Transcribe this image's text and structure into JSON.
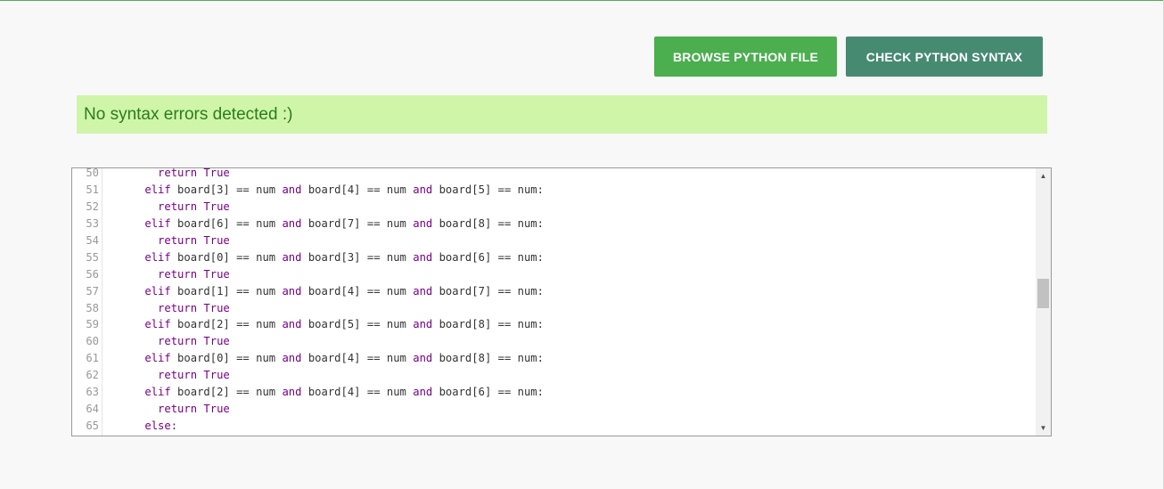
{
  "toolbar": {
    "browse_label": "BROWSE PYTHON FILE",
    "check_label": "CHECK PYTHON SYNTAX"
  },
  "status": {
    "message": "No syntax errors detected :)"
  },
  "colors": {
    "browse_button": "#4bae4f",
    "check_button": "#468a72",
    "success_bg": "#cff5a9",
    "success_text": "#2b7d1a",
    "keyword": "#770088"
  },
  "editor": {
    "lines": [
      {
        "num": "50",
        "indent": "      ",
        "parts": [
          {
            "t": "return True",
            "k": true
          }
        ]
      },
      {
        "num": "51",
        "indent": "    ",
        "parts": [
          {
            "t": "elif",
            "k": true
          },
          {
            "t": " board[3] == num ",
            "k": false
          },
          {
            "t": "and",
            "k": true
          },
          {
            "t": " board[4] == num ",
            "k": false
          },
          {
            "t": "and",
            "k": true
          },
          {
            "t": " board[5] == num:",
            "k": false
          }
        ]
      },
      {
        "num": "52",
        "indent": "      ",
        "parts": [
          {
            "t": "return True",
            "k": true
          }
        ]
      },
      {
        "num": "53",
        "indent": "    ",
        "parts": [
          {
            "t": "elif",
            "k": true
          },
          {
            "t": " board[6] == num ",
            "k": false
          },
          {
            "t": "and",
            "k": true
          },
          {
            "t": " board[7] == num ",
            "k": false
          },
          {
            "t": "and",
            "k": true
          },
          {
            "t": " board[8] == num:",
            "k": false
          }
        ]
      },
      {
        "num": "54",
        "indent": "      ",
        "parts": [
          {
            "t": "return True",
            "k": true
          }
        ]
      },
      {
        "num": "55",
        "indent": "    ",
        "parts": [
          {
            "t": "elif",
            "k": true
          },
          {
            "t": " board[0] == num ",
            "k": false
          },
          {
            "t": "and",
            "k": true
          },
          {
            "t": " board[3] == num ",
            "k": false
          },
          {
            "t": "and",
            "k": true
          },
          {
            "t": " board[6] == num:",
            "k": false
          }
        ]
      },
      {
        "num": "56",
        "indent": "      ",
        "parts": [
          {
            "t": "return True",
            "k": true
          }
        ]
      },
      {
        "num": "57",
        "indent": "    ",
        "parts": [
          {
            "t": "elif",
            "k": true
          },
          {
            "t": " board[1] == num ",
            "k": false
          },
          {
            "t": "and",
            "k": true
          },
          {
            "t": " board[4] == num ",
            "k": false
          },
          {
            "t": "and",
            "k": true
          },
          {
            "t": " board[7] == num:",
            "k": false
          }
        ]
      },
      {
        "num": "58",
        "indent": "      ",
        "parts": [
          {
            "t": "return True",
            "k": true
          }
        ]
      },
      {
        "num": "59",
        "indent": "    ",
        "parts": [
          {
            "t": "elif",
            "k": true
          },
          {
            "t": " board[2] == num ",
            "k": false
          },
          {
            "t": "and",
            "k": true
          },
          {
            "t": " board[5] == num ",
            "k": false
          },
          {
            "t": "and",
            "k": true
          },
          {
            "t": " board[8] == num:",
            "k": false
          }
        ]
      },
      {
        "num": "60",
        "indent": "      ",
        "parts": [
          {
            "t": "return True",
            "k": true
          }
        ]
      },
      {
        "num": "61",
        "indent": "    ",
        "parts": [
          {
            "t": "elif",
            "k": true
          },
          {
            "t": " board[0] == num ",
            "k": false
          },
          {
            "t": "and",
            "k": true
          },
          {
            "t": " board[4] == num ",
            "k": false
          },
          {
            "t": "and",
            "k": true
          },
          {
            "t": " board[8] == num:",
            "k": false
          }
        ]
      },
      {
        "num": "62",
        "indent": "      ",
        "parts": [
          {
            "t": "return True",
            "k": true
          }
        ]
      },
      {
        "num": "63",
        "indent": "    ",
        "parts": [
          {
            "t": "elif",
            "k": true
          },
          {
            "t": " board[2] == num ",
            "k": false
          },
          {
            "t": "and",
            "k": true
          },
          {
            "t": " board[4] == num ",
            "k": false
          },
          {
            "t": "and",
            "k": true
          },
          {
            "t": " board[6] == num:",
            "k": false
          }
        ]
      },
      {
        "num": "64",
        "indent": "      ",
        "parts": [
          {
            "t": "return True",
            "k": true
          }
        ]
      },
      {
        "num": "65",
        "indent": "    ",
        "parts": [
          {
            "t": "else:",
            "k": true
          }
        ]
      }
    ],
    "scroll_up_icon": "triangle-up",
    "scroll_down_icon": "triangle-down"
  }
}
